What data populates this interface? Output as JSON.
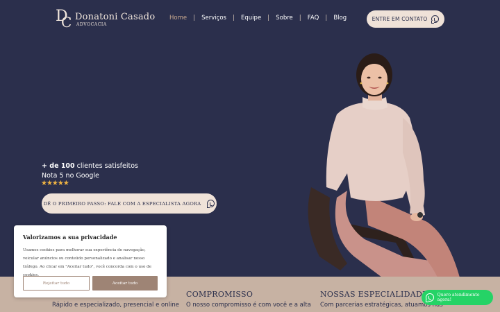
{
  "brand": {
    "mark_d": "D",
    "mark_c": "C",
    "name": "Donatoni Casado",
    "subtitle": "ADVOCACIA"
  },
  "nav": {
    "items": [
      {
        "label": "Home",
        "active": true
      },
      {
        "label": "Serviços"
      },
      {
        "label": "Equipe"
      },
      {
        "label": "Sobre"
      },
      {
        "label": "FAQ"
      },
      {
        "label": "Blog"
      }
    ],
    "separator": "|"
  },
  "header": {
    "contact_label": "ENTRE EM CONTATO",
    "contact_icon": "whatsapp-icon"
  },
  "hero": {
    "clients_bold": "+ de 100",
    "clients_rest": " clientes satisfeitos",
    "rating": "Nota 5 no Google",
    "stars": "★★★★★",
    "star_count": 5,
    "cta_label": "DÊ O PRIMEIRO PASSO: FALE COM A ESPECIALISTA AGORA"
  },
  "columns": [
    {
      "title": "",
      "text": "Rápido e especializado, presencial e online"
    },
    {
      "title": "COMPROMISSO",
      "text": "O nosso compromisso é com você e a alta"
    },
    {
      "title": "NOSSAS ESPECIALIDADES",
      "text": "Com parcerias estratégicas, atuamos nas"
    }
  ],
  "cookie": {
    "title": "Valorizamos a sua privacidade",
    "text": "Usamos cookies para melhorar sua experiência de navegação, veicular anúncios ou conteúdo personalizado e analisar nosso tráfego. Ao clicar em \"Aceitar tudo\", você concorda com o uso de cookies.",
    "reject_label": "Rejeitar tudo",
    "accept_label": "Aceitar tudo"
  },
  "whatsapp_float": {
    "label": "Quero atendimento agora!"
  },
  "colors": {
    "background": "#2b2f4c",
    "accent": "#c9a98f",
    "button_bg": "#efe2d8",
    "band": "#c7b2a3",
    "cookie_button": "#9e8475",
    "whatsapp": "#25d366",
    "star": "#f0b443"
  }
}
